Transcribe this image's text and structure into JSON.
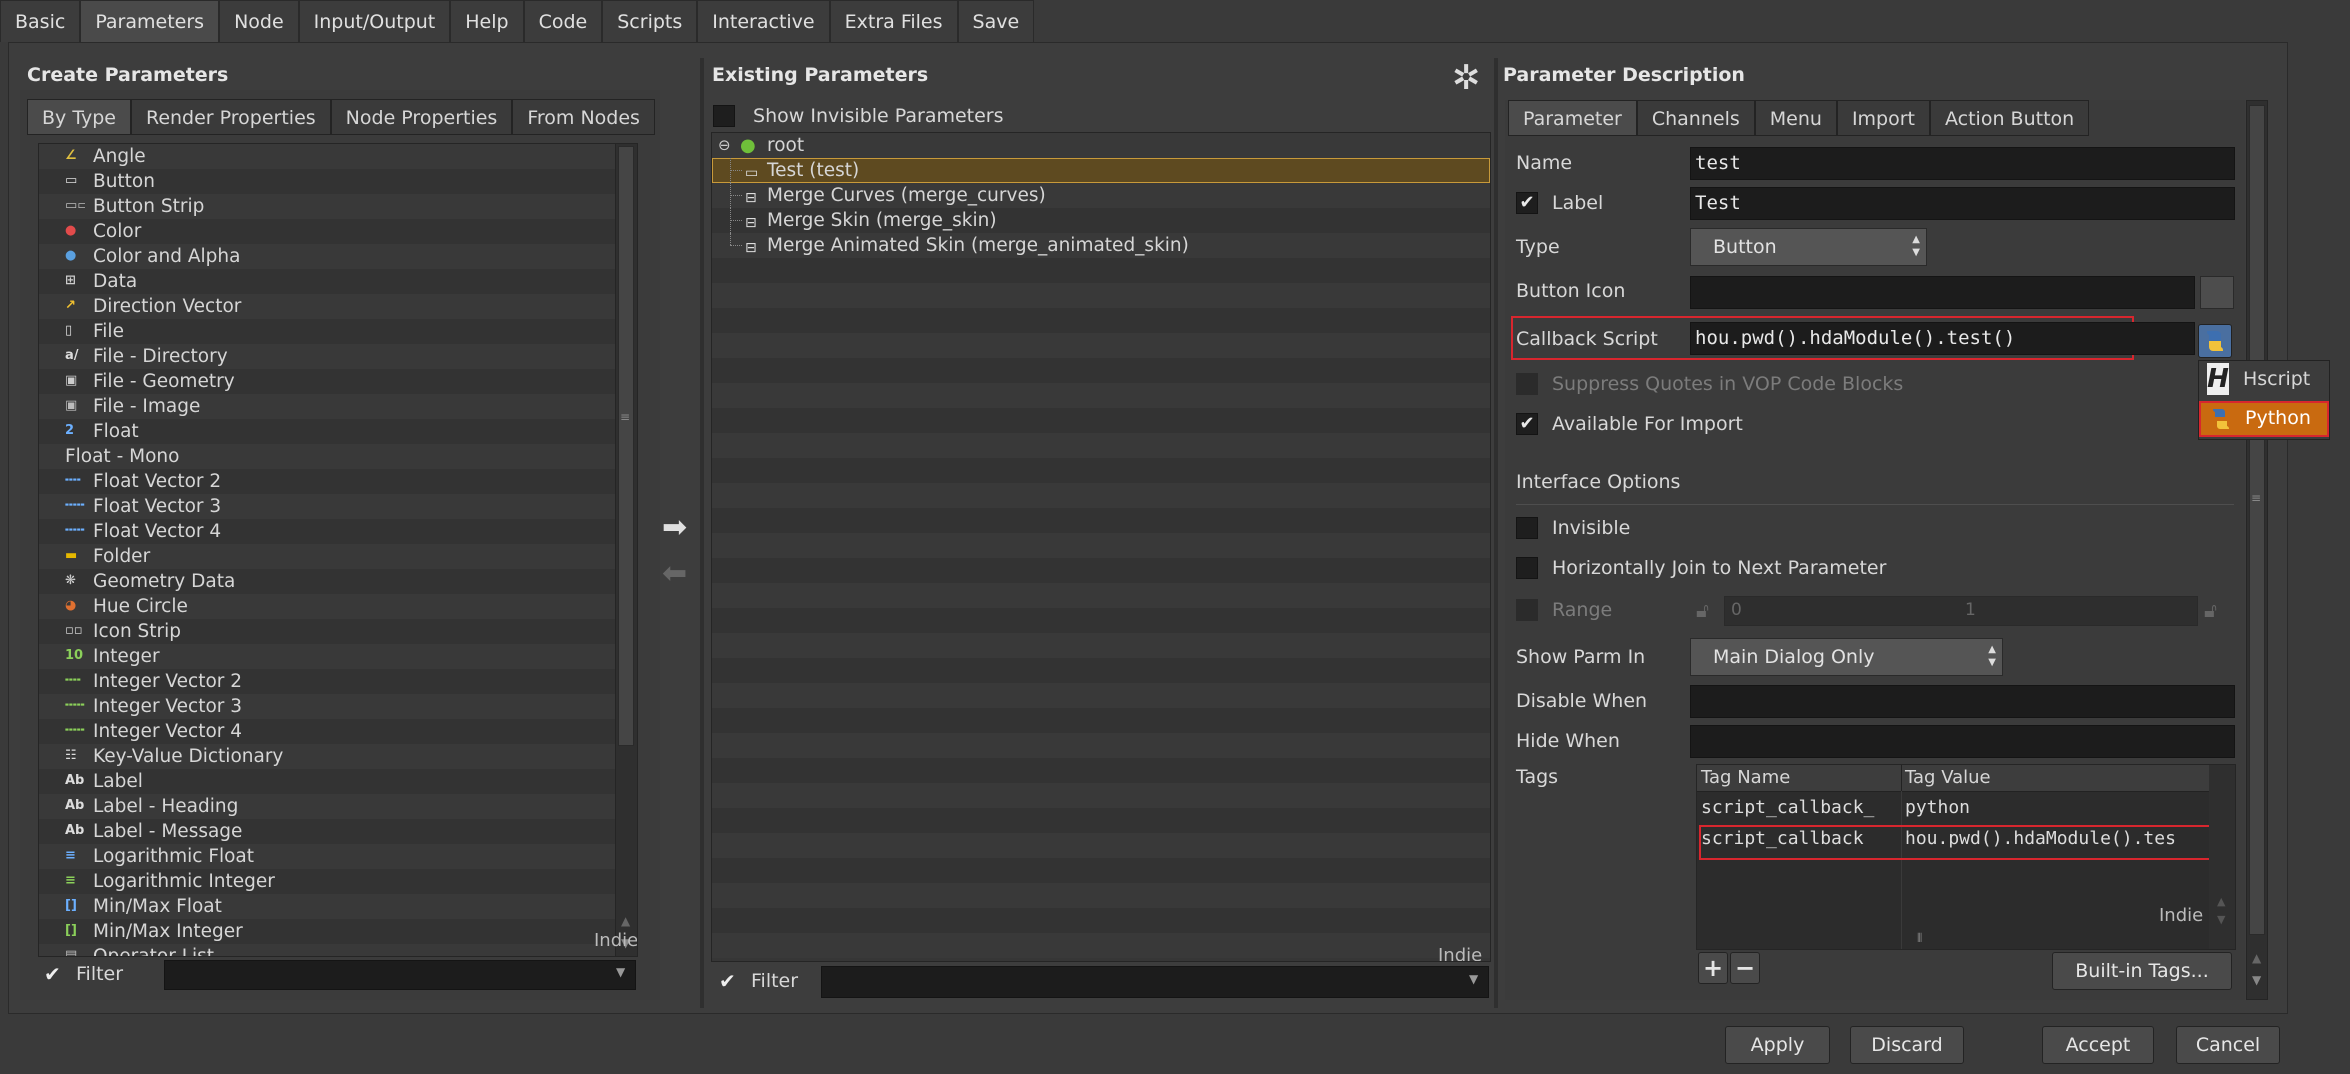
{
  "top_tabs": [
    "Basic",
    "Parameters",
    "Node",
    "Input/Output",
    "Help",
    "Code",
    "Scripts",
    "Interactive",
    "Extra Files",
    "Save"
  ],
  "active_top_tab": "Parameters",
  "create_parameters": {
    "title": "Create Parameters",
    "tabs": [
      "By Type",
      "Render Properties",
      "Node Properties",
      "From Nodes"
    ],
    "items": [
      {
        "label": "Angle",
        "icon": "angle-icon"
      },
      {
        "label": "Button",
        "icon": "button-icon"
      },
      {
        "label": "Button Strip",
        "icon": "button-strip-icon"
      },
      {
        "label": "Color",
        "icon": "color-icon"
      },
      {
        "label": "Color and Alpha",
        "icon": "color-alpha-icon"
      },
      {
        "label": "Data",
        "icon": "data-icon"
      },
      {
        "label": "Direction Vector",
        "icon": "direction-vector-icon"
      },
      {
        "label": "File",
        "icon": "file-icon"
      },
      {
        "label": "File - Directory",
        "icon": "file-directory-icon"
      },
      {
        "label": "File - Geometry",
        "icon": "file-geometry-icon"
      },
      {
        "label": "File - Image",
        "icon": "file-image-icon"
      },
      {
        "label": "Float",
        "icon": "float-icon"
      },
      {
        "label": "Float - Mono",
        "icon": ""
      },
      {
        "label": "Float Vector 2",
        "icon": "float-vector-2-icon"
      },
      {
        "label": "Float Vector 3",
        "icon": "float-vector-3-icon"
      },
      {
        "label": "Float Vector 4",
        "icon": "float-vector-4-icon"
      },
      {
        "label": "Folder",
        "icon": "folder-icon"
      },
      {
        "label": "Geometry Data",
        "icon": "geometry-data-icon"
      },
      {
        "label": "Hue Circle",
        "icon": "hue-circle-icon"
      },
      {
        "label": "Icon Strip",
        "icon": "icon-strip-icon"
      },
      {
        "label": "Integer",
        "icon": "integer-icon"
      },
      {
        "label": "Integer Vector 2",
        "icon": "integer-vector-2-icon"
      },
      {
        "label": "Integer Vector 3",
        "icon": "integer-vector-3-icon"
      },
      {
        "label": "Integer Vector 4",
        "icon": "integer-vector-4-icon"
      },
      {
        "label": "Key-Value Dictionary",
        "icon": "key-value-icon"
      },
      {
        "label": "Label",
        "icon": "label-icon"
      },
      {
        "label": "Label - Heading",
        "icon": "label-heading-icon"
      },
      {
        "label": "Label - Message",
        "icon": "label-message-icon"
      },
      {
        "label": "Logarithmic Float",
        "icon": "log-float-icon"
      },
      {
        "label": "Logarithmic Integer",
        "icon": "log-integer-icon"
      },
      {
        "label": "Min/Max Float",
        "icon": "minmax-float-icon"
      },
      {
        "label": "Min/Max Integer",
        "icon": "minmax-integer-icon"
      },
      {
        "label": "Operator List",
        "icon": "operator-list-icon"
      }
    ],
    "watermark": "Indie",
    "filter_label": "Filter"
  },
  "existing_parameters": {
    "title": "Existing Parameters",
    "show_invisible_label": "Show Invisible Parameters",
    "root_label": "root",
    "items": [
      {
        "label": "Test (test)",
        "selected": true
      },
      {
        "label": "Merge Curves (merge_curves)",
        "selected": false
      },
      {
        "label": "Merge Skin (merge_skin)",
        "selected": false
      },
      {
        "label": "Merge Animated Skin (merge_animated_skin)",
        "selected": false
      }
    ],
    "watermark": "Indie",
    "filter_label": "Filter"
  },
  "parameter_description": {
    "title": "Parameter Description",
    "tabs": [
      "Parameter",
      "Channels",
      "Menu",
      "Import",
      "Action Button"
    ],
    "name_label": "Name",
    "name_value": "test",
    "label_label": "Label",
    "label_value": "Test",
    "type_label": "Type",
    "type_value": "Button",
    "button_icon_label": "Button Icon",
    "callback_label": "Callback Script",
    "callback_value": "hou.pwd().hdaModule().test()",
    "suppress_quotes_label": "Suppress Quotes in VOP Code Blocks",
    "available_import_label": "Available For Import",
    "interface_options_label": "Interface Options",
    "invisible_label": "Invisible",
    "horiz_join_label": "Horizontally Join to Next Parameter",
    "range_label": "Range",
    "range_min": "0",
    "range_max": "1",
    "show_parm_in_label": "Show Parm In",
    "show_parm_in_value": "Main Dialog Only",
    "disable_when_label": "Disable When",
    "hide_when_label": "Hide When",
    "tags_label": "Tags",
    "tag_columns": [
      "Tag Name",
      "Tag Value"
    ],
    "tags": [
      {
        "name": "script_callback_",
        "value": "python"
      },
      {
        "name": "script_callback",
        "value": "hou.pwd().hdaModule().tes"
      }
    ],
    "watermark": "Indie",
    "builtin_tags_label": "Built-in Tags...",
    "plus_label": "+",
    "minus_label": "−"
  },
  "language_menu": {
    "items": [
      "Hscript",
      "Python"
    ],
    "selected": "Python"
  },
  "footer_buttons": [
    "Apply",
    "Discard",
    "Accept",
    "Cancel"
  ],
  "colors": {
    "accent": "#c96a10",
    "selection": "#5e4a20",
    "highlight_border": "#d8262e"
  }
}
